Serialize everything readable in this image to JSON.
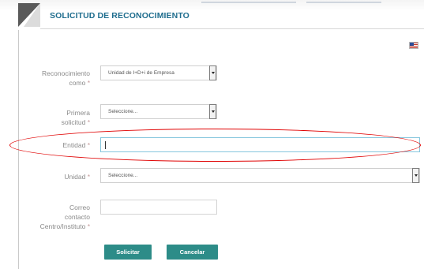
{
  "header": {
    "title": "SOLICITUD DE RECONOCIMIENTO"
  },
  "icons": {
    "language_flag": "us-flag-icon"
  },
  "form": {
    "reconocimiento": {
      "label_line1": "Reconocimiento",
      "label_line2": "como",
      "required": "*",
      "value": "Unidad de I+D+i de Empresa"
    },
    "primera_solicitud": {
      "label_line1": "Primera",
      "label_line2": "solicitud",
      "required": "*",
      "value": "Seleccione..."
    },
    "entidad": {
      "label": "Entidad",
      "required": "*",
      "value": ""
    },
    "unidad": {
      "label": "Unidad",
      "required": "*",
      "value": "Seleccione..."
    },
    "correo": {
      "label_line1": "Correo",
      "label_line2": "contacto",
      "label_line3": "Centro/Instituto",
      "required": "*",
      "value": ""
    }
  },
  "buttons": {
    "solicitar": "Solicitar",
    "cancelar": "Cancelar"
  },
  "colors": {
    "title": "#1f6d8e",
    "button": "#2d8c88",
    "highlight": "#e00000",
    "focus_border": "#86c6dd"
  }
}
